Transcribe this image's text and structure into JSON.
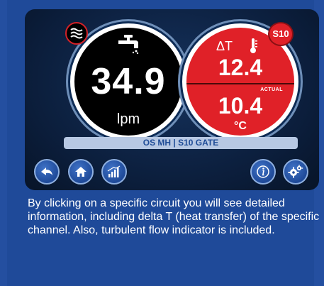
{
  "dial_flow": {
    "value": "34.9",
    "unit": "lpm"
  },
  "dial_temp": {
    "delta_label": "ΔT",
    "delta_value": "12.4",
    "actual_label": "ACTUAL",
    "actual_value": "10.4",
    "actual_unit": "°C"
  },
  "badge": {
    "label": "S10"
  },
  "circuit_bar": {
    "left": "OS MH",
    "separator": "|",
    "right": "S10 GATE"
  },
  "nav": {
    "icons": [
      "back-arrow-icon",
      "home-icon",
      "signal-chart-icon",
      "info-icon",
      "settings-gears-icon"
    ]
  },
  "caption": {
    "text": "By clicking on a specific circuit you will see detailed information, including delta T (heat transfer) of the specific channel. Also, turbulent flow indicator is included."
  },
  "colors": {
    "background": "#244fa0",
    "dial_red": "#e02128",
    "accent_blue": "#1f4a99"
  }
}
